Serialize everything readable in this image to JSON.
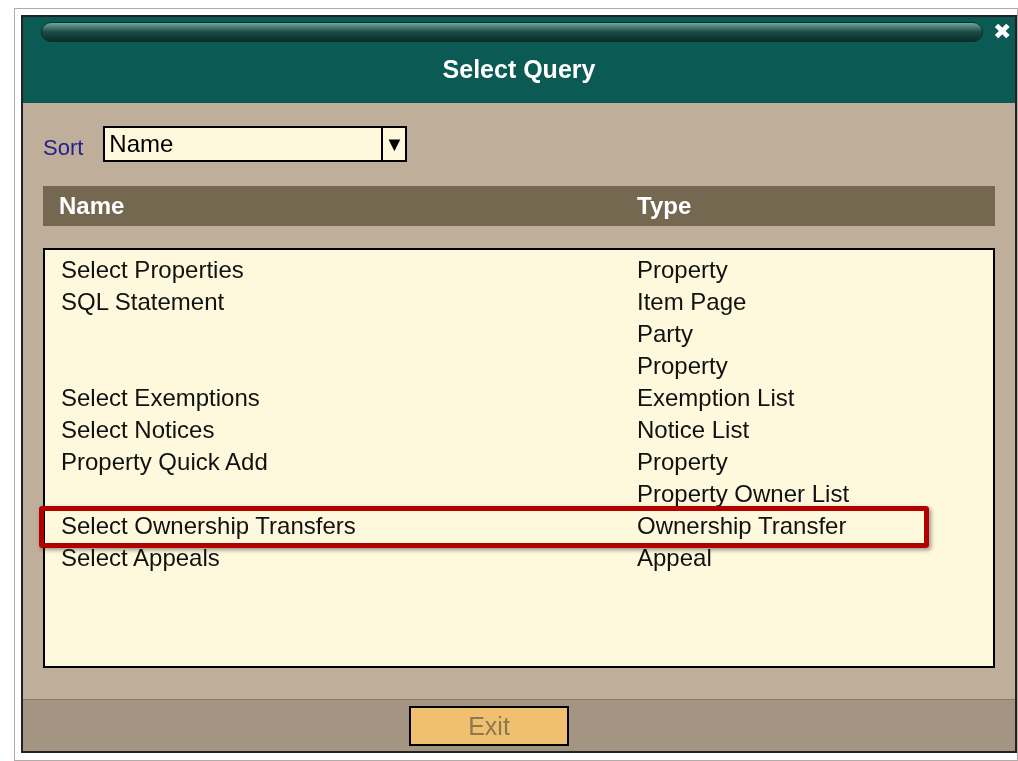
{
  "window": {
    "title": "Select Query",
    "close": "✖"
  },
  "sort": {
    "label": "Sort",
    "value": "Name",
    "arrow": "▼"
  },
  "table": {
    "columns": [
      "Name",
      "Type"
    ],
    "rows": [
      {
        "name": "Select Properties",
        "type": "Property",
        "highlighted": false
      },
      {
        "name": "SQL Statement",
        "type": "Item Page",
        "highlighted": false
      },
      {
        "name": "",
        "type": "Party",
        "highlighted": false
      },
      {
        "name": "",
        "type": "Property",
        "highlighted": false
      },
      {
        "name": "Select Exemptions",
        "type": "Exemption List",
        "highlighted": false
      },
      {
        "name": "Select Notices",
        "type": "Notice List",
        "highlighted": false
      },
      {
        "name": "Property Quick Add",
        "type": "Property",
        "highlighted": false
      },
      {
        "name": "",
        "type": "Property Owner List",
        "highlighted": false
      },
      {
        "name": "Select Ownership Transfers",
        "type": "Ownership Transfer",
        "highlighted": true
      },
      {
        "name": "Select Appeals",
        "type": "Appeal",
        "highlighted": false
      }
    ]
  },
  "footer": {
    "button": {
      "label": "Exit",
      "disabled": true
    }
  }
}
